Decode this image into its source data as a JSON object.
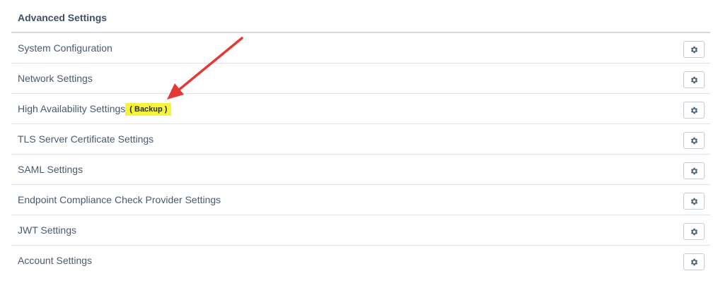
{
  "header": {
    "title": "Advanced Settings"
  },
  "rows": [
    {
      "label": "System Configuration"
    },
    {
      "label": "Network Settings"
    },
    {
      "label": "High Availability Settings",
      "badge": "( Backup )"
    },
    {
      "label": "TLS Server Certificate Settings"
    },
    {
      "label": "SAML Settings"
    },
    {
      "label": "Endpoint Compliance Check Provider Settings"
    },
    {
      "label": "JWT Settings"
    },
    {
      "label": "Account Settings"
    }
  ],
  "icons": {
    "row_action": "gear-icon"
  },
  "colors": {
    "badge_highlight": "#f5f33a",
    "annotation_arrow": "#e53935",
    "text": "#4a5a6e"
  }
}
